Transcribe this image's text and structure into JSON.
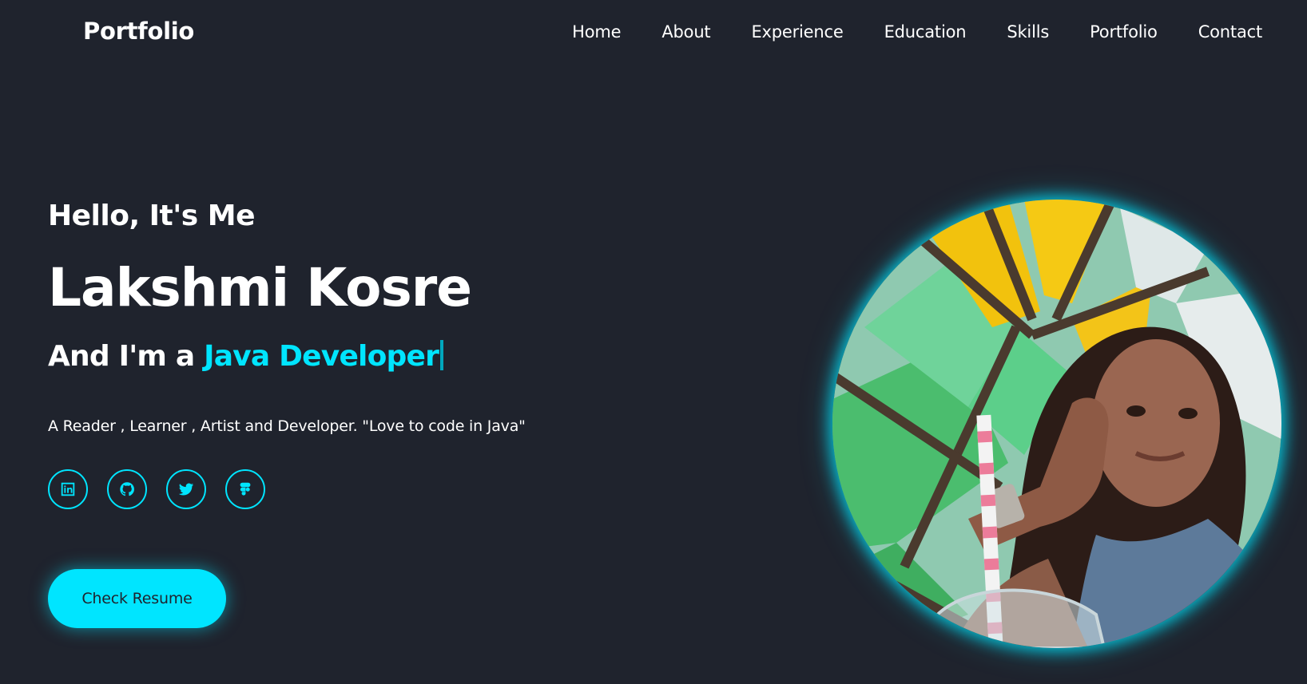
{
  "header": {
    "logo": "Portfolio",
    "nav": [
      "Home",
      "About",
      "Experience",
      "Education",
      "Skills",
      "Portfolio",
      "Contact"
    ]
  },
  "hero": {
    "greeting": "Hello, It's Me",
    "name": "Lakshmi Kosre",
    "role_prefix": "And I'm a",
    "role_highlight": "Java Developer",
    "tagline": "A Reader , Learner , Artist and Developer. \"Love to code in Java\"",
    "resume_label": "Check Resume"
  },
  "social": [
    "linkedin-icon",
    "github-icon",
    "twitter-icon",
    "figma-icon"
  ],
  "colors": {
    "background": "#1f232d",
    "accent": "#00e5ff",
    "text": "#ffffff"
  }
}
